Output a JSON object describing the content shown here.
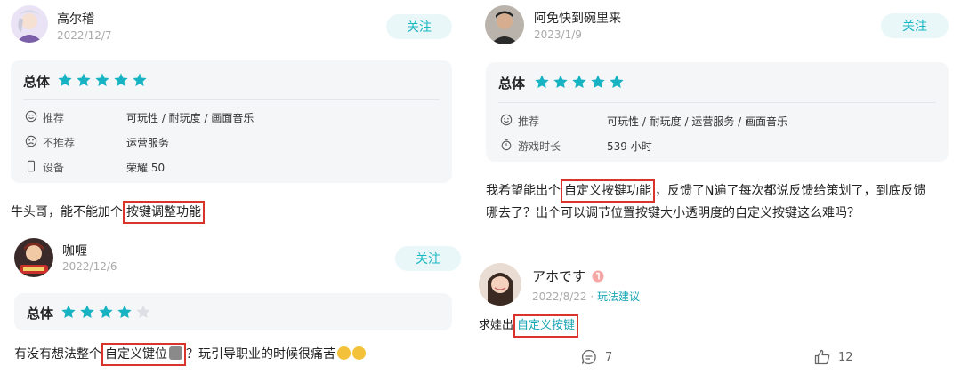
{
  "colors": {
    "accent": "#19b7c4",
    "star_on": "#17b3c2",
    "star_off": "#dcdfe3",
    "highlight": "#d9342b"
  },
  "left": {
    "review1": {
      "user": "高尔稽",
      "date": "2022/12/7",
      "follow": "关注",
      "card_title": "总体",
      "stars": 5,
      "rows": [
        {
          "icon": "smile-icon",
          "label": "推荐",
          "value": "可玩性 / 耐玩度 / 画面音乐"
        },
        {
          "icon": "frown-icon",
          "label": "不推荐",
          "value": "运营服务"
        },
        {
          "icon": "phone-icon",
          "label": "设备",
          "value": "荣耀 50"
        }
      ],
      "text_pre": "牛头哥，能不能加个",
      "text_hl": "按键调整功能"
    },
    "review2": {
      "user": "咖喱",
      "date": "2022/12/6",
      "follow": "关注",
      "card_title": "总体",
      "stars": 4,
      "text_pre": "有没有想法整个",
      "text_hl": "自定义键位",
      "text_post": "？玩引导职业的时候很痛苦"
    }
  },
  "right": {
    "review1": {
      "user": "阿免快到碗里来",
      "date": "2023/1/9",
      "follow": "关注",
      "card_title": "总体",
      "stars": 5,
      "rows": [
        {
          "icon": "smile-icon",
          "label": "推荐",
          "value": "可玩性 / 耐玩度 / 运营服务 / 画面音乐"
        },
        {
          "icon": "stopwatch-icon",
          "label": "游戏时长",
          "value": "539 小时"
        }
      ],
      "text_pre": "我希望能出个",
      "text_hl": "自定义按键功能",
      "text_post": "，反馈了N遍了每次都说反馈给策划了，到底反馈",
      "text_line2": "哪去了？出个可以调节位置按键大小透明度的自定义按键这么难吗？"
    },
    "reply": {
      "user": "アホです",
      "date": "2022/8/22",
      "sep": "·",
      "tag": "玩法建议",
      "text_pre": "求娃出",
      "text_hl": "自定义按键",
      "comments": "7",
      "likes": "12"
    }
  }
}
